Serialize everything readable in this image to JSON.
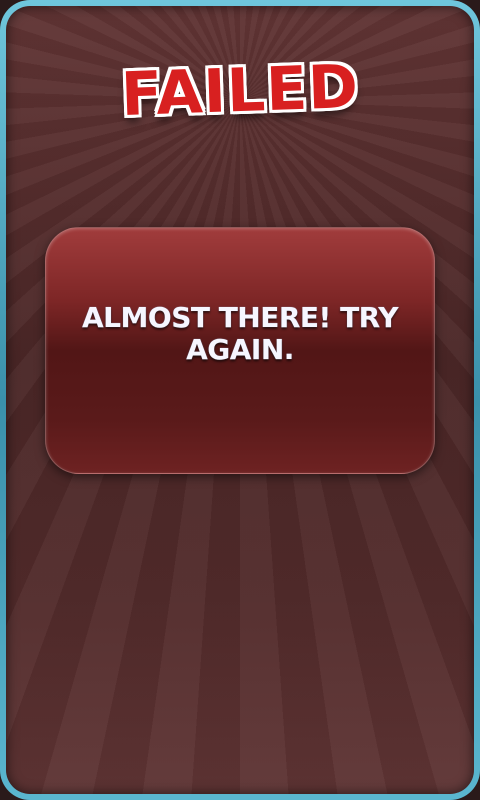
{
  "screen": {
    "title": "FAILED",
    "message": "ALMOST THERE! TRY AGAIN."
  },
  "colors": {
    "frame_border": "#4fb1cb",
    "panel_background": "#512b2b",
    "title_fill": "#d82020",
    "title_outline": "#ffffff",
    "message_box": "#6a1e1e",
    "message_text": "#f6f6ff"
  }
}
